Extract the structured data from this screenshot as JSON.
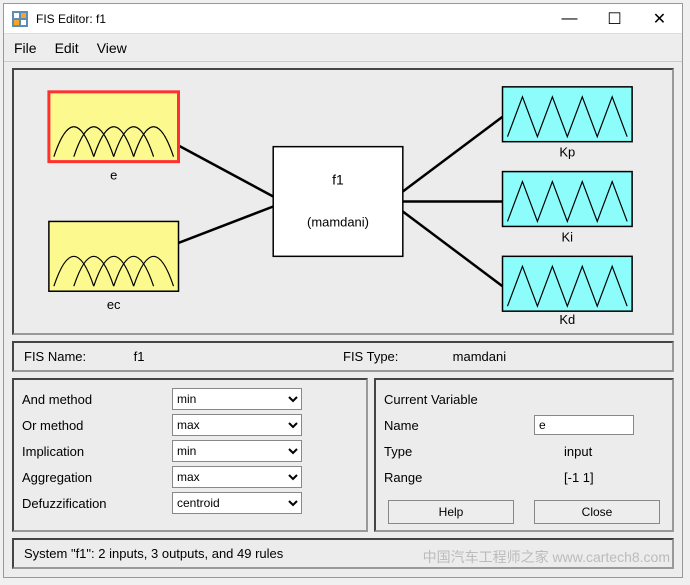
{
  "window": {
    "title": "FIS Editor: f1",
    "minimize": "—",
    "maximize": "☐",
    "close": "✕"
  },
  "menu": {
    "file": "File",
    "edit": "Edit",
    "view": "View"
  },
  "diagram": {
    "inputs": [
      "e",
      "ec"
    ],
    "center_name": "f1",
    "center_type": "(mamdani)",
    "outputs": [
      "Kp",
      "Ki",
      "Kd"
    ]
  },
  "info": {
    "name_label": "FIS Name:",
    "name_value": "f1",
    "type_label": "FIS Type:",
    "type_value": "mamdani"
  },
  "methods": {
    "and": {
      "label": "And method",
      "value": "min"
    },
    "or": {
      "label": "Or method",
      "value": "max"
    },
    "imp": {
      "label": "Implication",
      "value": "min"
    },
    "agg": {
      "label": "Aggregation",
      "value": "max"
    },
    "defuzz": {
      "label": "Defuzzification",
      "value": "centroid"
    }
  },
  "currentvar": {
    "heading": "Current Variable",
    "name_label": "Name",
    "name_value": "e",
    "type_label": "Type",
    "type_value": "input",
    "range_label": "Range",
    "range_value": "[-1 1]"
  },
  "buttons": {
    "help": "Help",
    "close": "Close"
  },
  "status": "System \"f1\": 2 inputs, 3 outputs, and 49 rules",
  "watermark": "中国汽车工程师之家\nwww.cartech8.com"
}
